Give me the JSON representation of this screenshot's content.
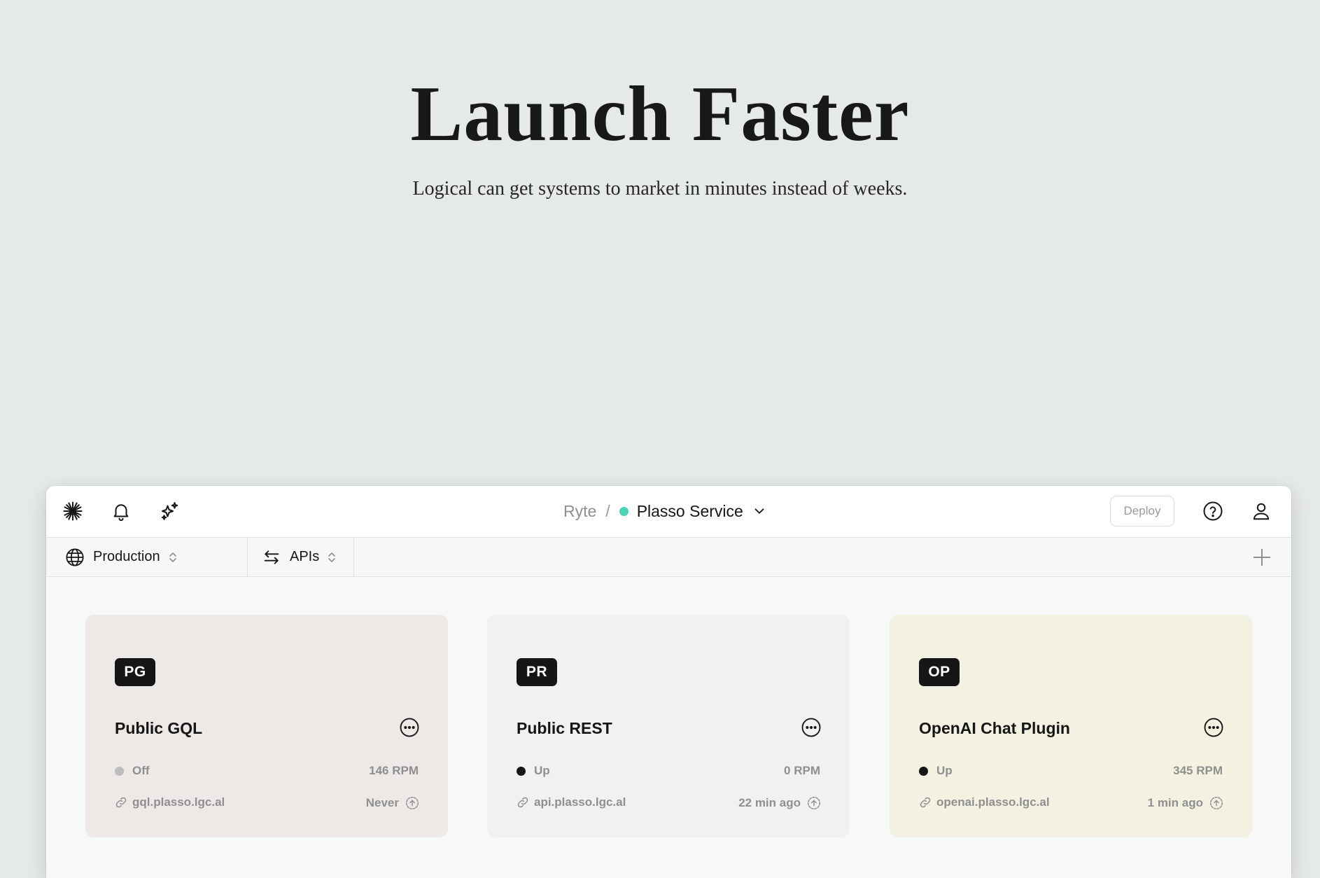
{
  "hero": {
    "title": "Launch Faster",
    "subtitle": "Logical can get systems to market in minutes instead of weeks."
  },
  "topbar": {
    "icons": [
      "asterisk-logo-icon",
      "bell-icon",
      "sparkles-icon"
    ],
    "breadcrumb": {
      "org": "Ryte",
      "separator": "/",
      "service": "Plasso Service",
      "status_color": "#4fd1b3"
    },
    "deploy_label": "Deploy",
    "right_icons": [
      "help-icon",
      "user-icon"
    ]
  },
  "subbar": {
    "environment": "Production",
    "section": "APIs"
  },
  "cards": [
    {
      "badge": "PG",
      "title": "Public GQL",
      "status": "Off",
      "status_color": "#bdbdbd",
      "rpm": "146 RPM",
      "url": "gql.plasso.lgc.al",
      "deployed": "Never",
      "background": "#ede9e6"
    },
    {
      "badge": "PR",
      "title": "Public REST",
      "status": "Up",
      "status_color": "#161616",
      "rpm": "0 RPM",
      "url": "api.plasso.lgc.al",
      "deployed": "22 min ago",
      "background": "#f1f1f0"
    },
    {
      "badge": "OP",
      "title": "OpenAI Chat Plugin",
      "status": "Up",
      "status_color": "#161616",
      "rpm": "345 RPM",
      "url": "openai.plasso.lgc.al",
      "deployed": "1 min ago",
      "background": "#f3f1e2"
    }
  ]
}
